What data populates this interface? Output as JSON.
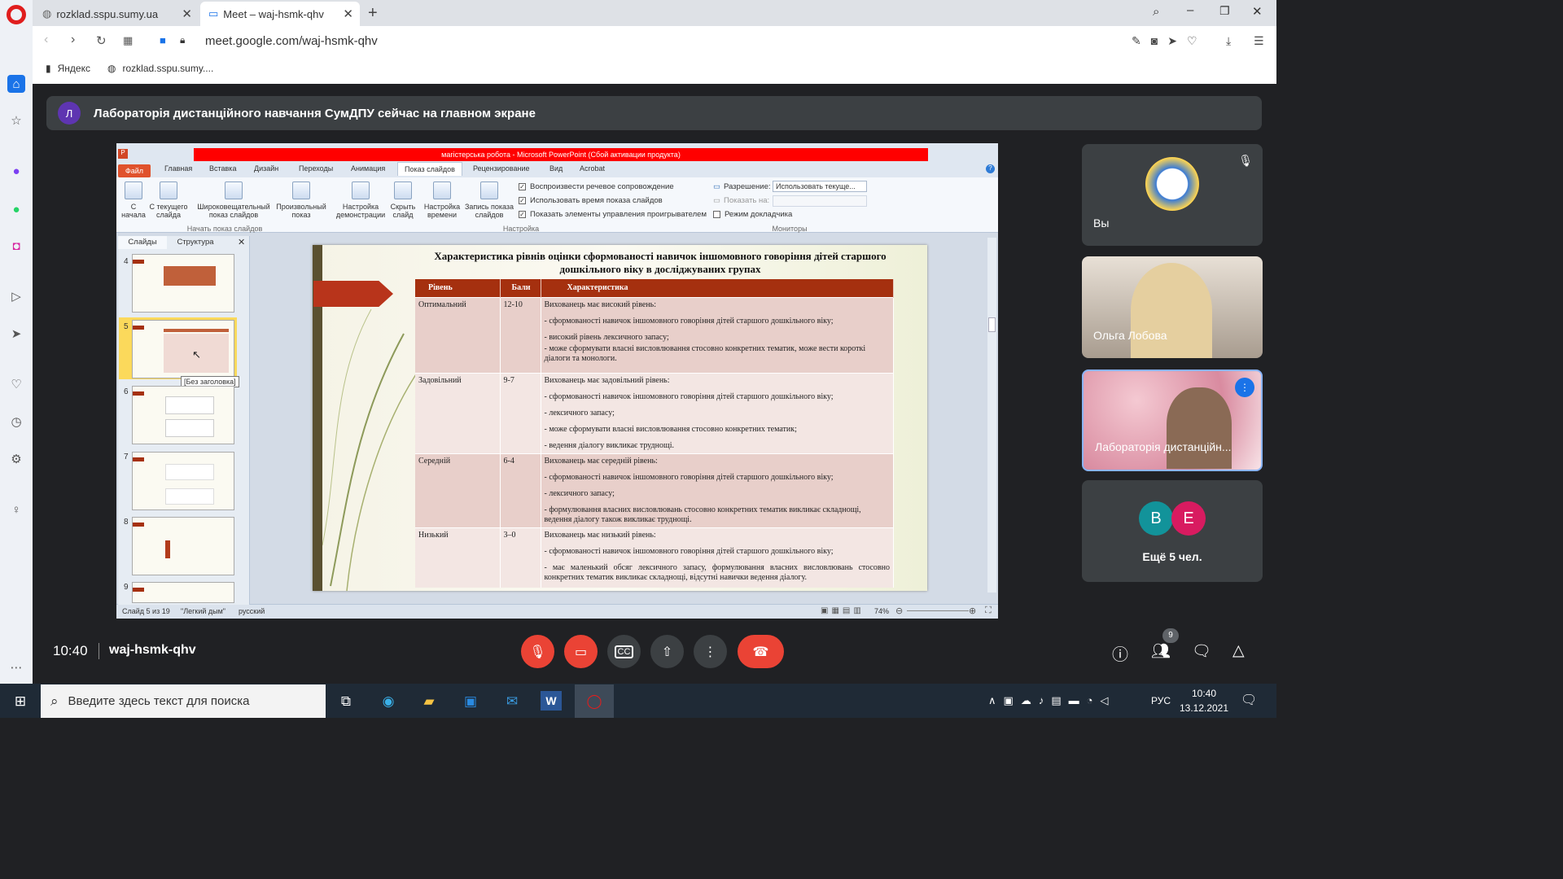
{
  "browser": {
    "tabs": [
      {
        "title": "rozklad.sspu.sumy.ua"
      },
      {
        "title": "Meet – waj-hsmk-qhv"
      }
    ],
    "url": "meet.google.com/waj-hsmk-qhv",
    "bookmarks": [
      "Яндекс",
      "rozklad.sspu.sumy...."
    ]
  },
  "banner": {
    "avatar": "Л",
    "text": "Лабораторія дистанційного навчання СумДПУ сейчас на главном экране"
  },
  "ppt": {
    "title": "магістерська робота - Microsoft PowerPoint (Сбой активации продукта)",
    "file_tab": "Файл",
    "tabs": [
      "Главная",
      "Вставка",
      "Дизайн",
      "Переходы",
      "Анимация",
      "Показ слайдов",
      "Рецензирование",
      "Вид",
      "Acrobat"
    ],
    "buttons": [
      "С начала",
      "С текущего слайда",
      "Широковещательный показ слайдов",
      "Произвольный показ"
    ],
    "group1": "Начать показ слайдов",
    "buttons2": [
      "Настройка демонстрации",
      "Скрыть слайд",
      "Настройка времени",
      "Запись показа слайдов"
    ],
    "checks": [
      "Воспроизвести речевое сопровождение",
      "Использовать время показа слайдов",
      "Показать элементы управления проигрывателем"
    ],
    "group2": "Настройка",
    "res_label": "Разрешение:",
    "res_value": "Использовать текуще...",
    "show_on": "Показать на:",
    "presenter": "Режим докладчика",
    "group3": "Мониторы",
    "panel_tabs": [
      "Слайды",
      "Структура"
    ],
    "thumb_nums": [
      "4",
      "5",
      "6",
      "7",
      "8",
      "9"
    ],
    "tooltip": "[Без заголовка]",
    "status": [
      "Слайд 5 из 19",
      "\"Легкий дым\"",
      "русский"
    ],
    "zoom": "74%"
  },
  "slide": {
    "title": "Характеристика рівнів оцінки сформованості навичок іншомовного говоріння дітей старшого дошкільного віку в досліджуваних групах",
    "headers": [
      "Рівень",
      "Бали",
      "Характеристика"
    ],
    "rows": [
      {
        "level": "Оптимальний",
        "score": "12-10",
        "lines": [
          "Вихованець  має високий рівень:",
          "- сформованості навичок іншомовного говоріння дітей  старшого дошкільного віку;",
          "- високий рівень лексичного запасу;",
          "- може сформувати власні висловлювання стосовно конкретних тематик, може вести короткі діалоги та монологи."
        ]
      },
      {
        "level": "Задовільний",
        "score": "9-7",
        "lines": [
          "Вихованець  має задовільний рівень:",
          "- сформованості навичок іншомовного говоріння дітей  старшого дошкільного віку;",
          "-  лексичного запасу;",
          "-  може сформувати власні висловлювання стосовно конкретних тематик;",
          "- ведення діалогу викликає труднощі."
        ]
      },
      {
        "level": "Середній",
        "score": "6-4",
        "lines": [
          "Вихованець  має середній рівень:",
          " - сформованості навичок іншомовного говоріння дітей  старшого дошкільного віку;",
          "- лексичного запасу;",
          "- формулювання  власних висловлювань стосовно конкретних тематик  викликає складнощі, ведення діалогу також викликає труднощі."
        ]
      },
      {
        "level": "Низький",
        "score": "3–0",
        "lines": [
          "Вихованець  має низький рівень:",
          "-     сформованості навичок іншомовного говоріння дітей  старшого дошкільного віку;",
          "-  має маленький обсяг лексичного запасу, формулювання   власних висловлювань стосовно конкретних тематик викликає складнощі, відсутні навички ведення діалогу."
        ]
      }
    ]
  },
  "participants": [
    {
      "name": "Вы"
    },
    {
      "name": "Ольга Лобова"
    },
    {
      "name": "Лабораторія дистанційн..."
    }
  ],
  "more": {
    "avatars": [
      "В",
      "Е"
    ],
    "label": "Ещё 5 чел."
  },
  "meeting": {
    "time": "10:40",
    "code": "waj-hsmk-qhv",
    "people_count": "9"
  },
  "taskbar": {
    "search": "Введите здесь текст для поиска",
    "lang": "РУС",
    "time": "10:40",
    "date": "13.12.2021"
  },
  "colors": {
    "accent": "#a5300f",
    "end_call": "#ea4335",
    "meet_bg": "#202124"
  }
}
